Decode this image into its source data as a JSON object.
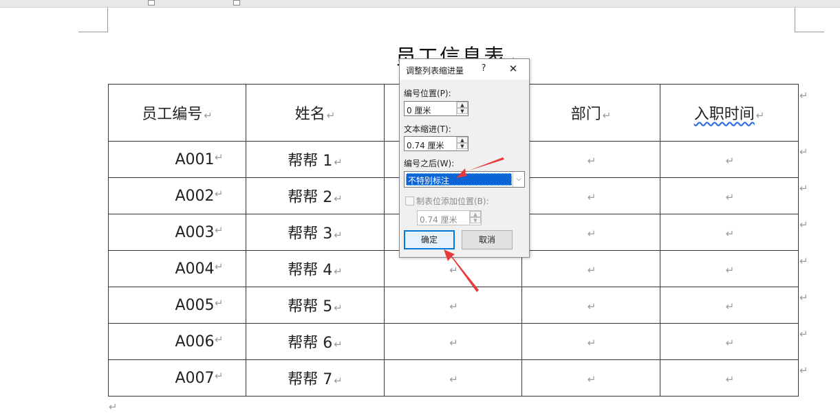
{
  "document": {
    "title": "员工信息表",
    "paragraph_mark": "↵",
    "table": {
      "headers": [
        "员工编号",
        "姓名",
        "",
        "部门",
        "入职时间"
      ],
      "rows": [
        [
          "A001",
          "帮帮 1"
        ],
        [
          "A002",
          "帮帮 2"
        ],
        [
          "A003",
          "帮帮 3"
        ],
        [
          "A004",
          "帮帮 4"
        ],
        [
          "A005",
          "帮帮 5"
        ],
        [
          "A006",
          "帮帮 6"
        ],
        [
          "A007",
          "帮帮 7"
        ]
      ]
    }
  },
  "dialog": {
    "title": "调整列表缩进量",
    "help": "?",
    "close": "✕",
    "number_position_label": "编号位置(P):",
    "number_position_value": "0 厘米",
    "text_indent_label": "文本缩进(T):",
    "text_indent_value": "0.74 厘米",
    "after_number_label": "编号之后(W):",
    "after_number_value": "不特别标注",
    "tab_stop_label": "制表位添加位置(B):",
    "tab_stop_value": "0.74 厘米",
    "ok_label": "确定",
    "cancel_label": "取消"
  },
  "colors": {
    "selection": "#0a64d6",
    "ok_border": "#0078d7",
    "annotation_arrow": "#e83a3a"
  },
  "icons": {
    "paragraph_mark": "return-arrow-icon",
    "spin_up": "triangle-up-icon",
    "spin_down": "triangle-down-icon",
    "dropdown": "chevron-down-icon",
    "close": "close-icon",
    "help": "question-icon"
  }
}
